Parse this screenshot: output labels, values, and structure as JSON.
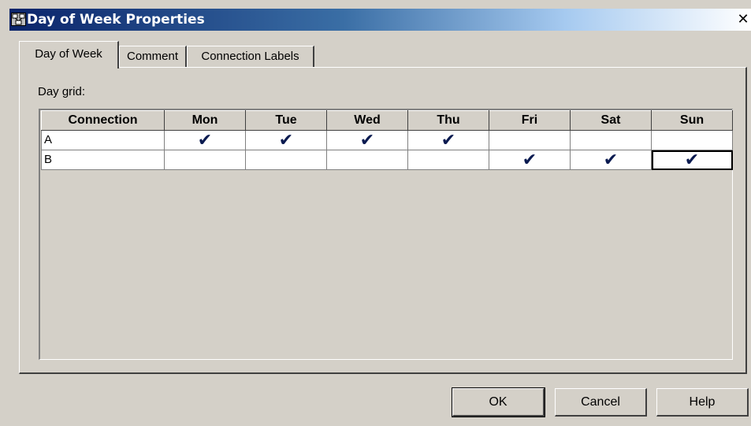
{
  "window": {
    "title": "Day of Week Properties",
    "close_glyph": "✕"
  },
  "tabs": [
    {
      "label": "Day of Week",
      "active": true
    },
    {
      "label": "Comment",
      "active": false
    },
    {
      "label": "Connection Labels",
      "active": false
    }
  ],
  "grid": {
    "label": "Day grid:",
    "columns": [
      "Connection",
      "Mon",
      "Tue",
      "Wed",
      "Thu",
      "Fri",
      "Sat",
      "Sun"
    ],
    "check_glyph": "✔",
    "rows": [
      {
        "name": "A",
        "days": [
          true,
          true,
          true,
          true,
          false,
          false,
          false
        ]
      },
      {
        "name": "B",
        "days": [
          false,
          false,
          false,
          false,
          true,
          true,
          true
        ]
      }
    ],
    "selected_cell": {
      "row": 1,
      "day": 6
    }
  },
  "buttons": {
    "ok": "OK",
    "cancel": "Cancel",
    "help": "Help"
  },
  "colors": {
    "titlebar_start": "#0a246a",
    "titlebar_end": "#a6caf0",
    "face": "#d4d0c8",
    "check": "#0a1a50"
  }
}
